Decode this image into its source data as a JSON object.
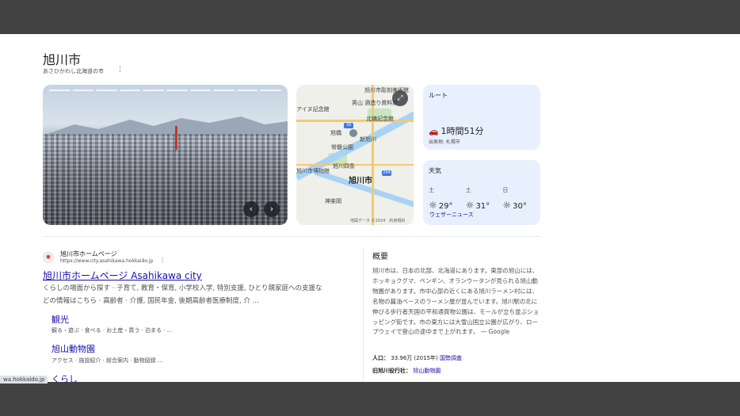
{
  "header": {
    "title": "旭川市",
    "subtitle": "あさひかわし北海道の市"
  },
  "route": {
    "heading": "ルート",
    "duration": "1時間51分",
    "origin": "出発地: 札幌市"
  },
  "weather": {
    "heading": "天気",
    "days": [
      {
        "day": "土",
        "temp": "29°"
      },
      {
        "day": "土",
        "temp": "31°"
      },
      {
        "day": "日",
        "temp": "30°"
      }
    ],
    "source_link": "ウェザーニュース"
  },
  "map": {
    "city_label": "旭川市",
    "labels": [
      "旭川市彫刻美術館",
      "アイヌ記念館",
      "男山 酒造り資料館",
      "北鎮記念館",
      "旭橋",
      "新旭川",
      "常磐公園",
      "旭川市博物館",
      "旭川四条",
      "神楽岡"
    ],
    "footer": "地図データ ©2024　利用規約",
    "route_badges": [
      "39",
      "294"
    ]
  },
  "result": {
    "site_name": "旭川市ホームページ",
    "url": "https://www.city.asahikawa.hokkaido.jp",
    "title": "旭川市ホームページ Asahikawa city",
    "snippet": "くらしの場面から探す · 子育て, 教育・保育, 小学校入学, 特別支援, ひとり親家庭への支援などの情報はこちら · 高齢者 · 介護, 国民年金, 後期高齢者医療制度, 介 ...",
    "sublinks": [
      {
        "title": "観光",
        "desc": "観る・遊ぶ · 食べる · お土産・買う · 泊まる · ..."
      },
      {
        "title": "旭山動物園",
        "desc": "アクセス · 施設紹介 · 総合案内 · 動物図録 ..."
      },
      {
        "title": "くらし",
        "desc": ""
      }
    ]
  },
  "overview": {
    "heading": "概要",
    "text": "旭川市は、日本の北部、北海道にあります。東部の旭山には、ホッキョクグマ、ペンギン、オランウータンが見られる旭山動物園があります。市中心部の近くにある旭川ラーメン村には、名物の醤油ベースのラーメン屋が並んでいます。旭川駅の北に伸びる歩行者天国の平和通買物公園は、モールが立ち並ぶショッピング街です。市の東方には大雪山国立公園が広がり、ロープウェイで登山の途中まで上がれます。",
    "source": " — Google",
    "population_label": "人口：",
    "population_value": "33.96万 (2015年)",
    "population_link": "国勢調査",
    "office_label": "旧旭川役行社：",
    "office_value": "旭山動物園"
  },
  "status_bar": {
    "url": "wa.hokkaido.jp"
  }
}
